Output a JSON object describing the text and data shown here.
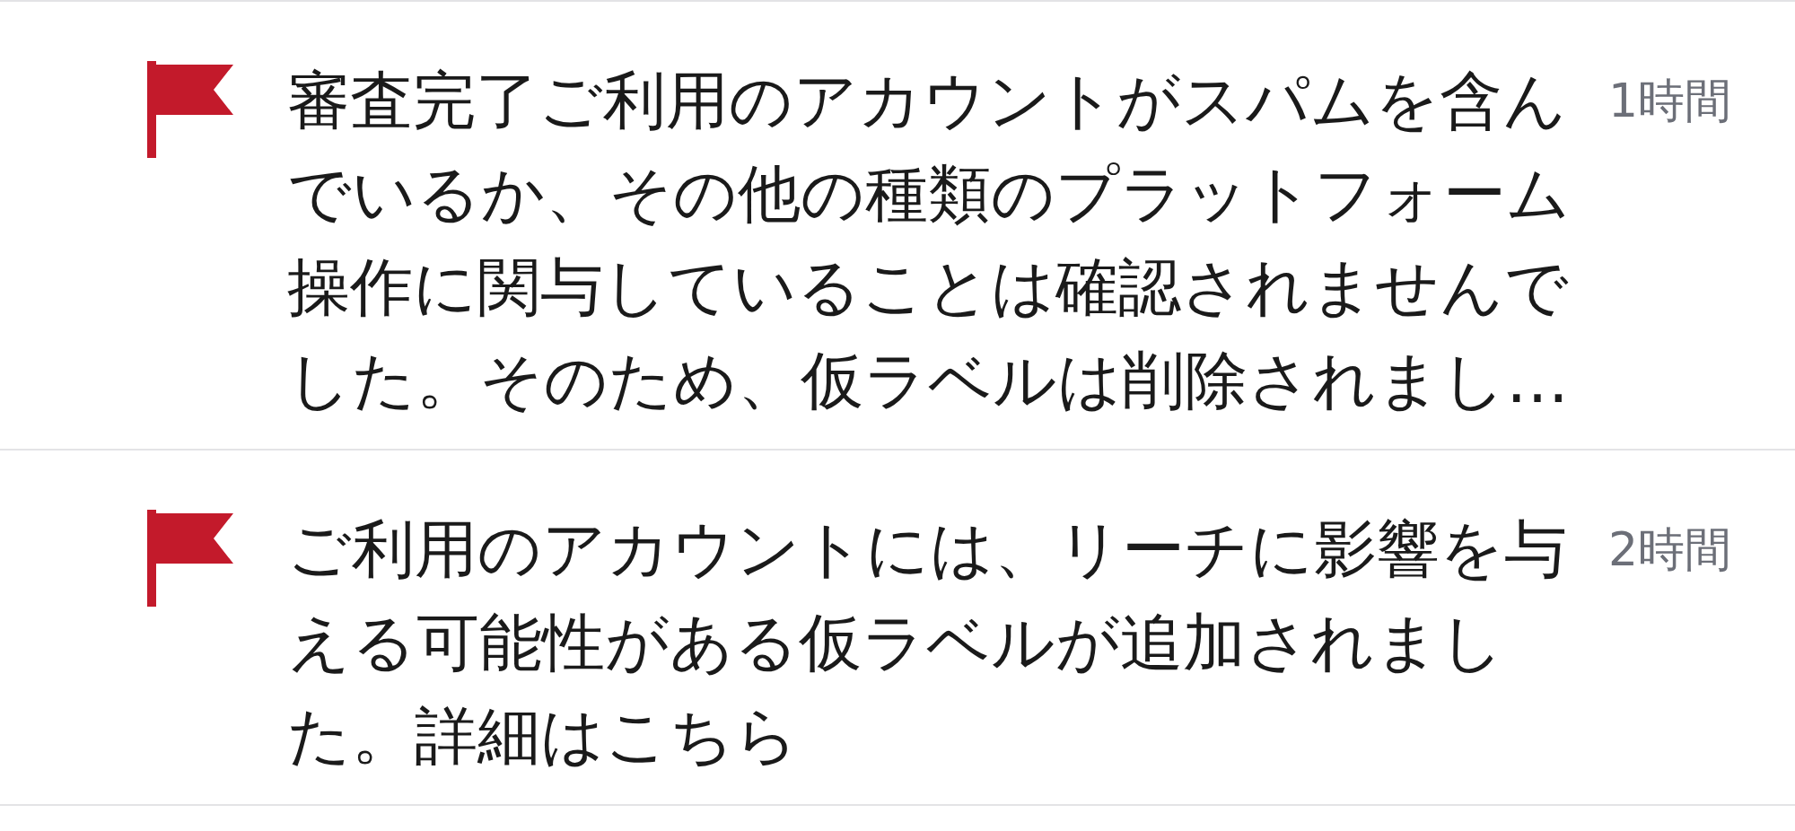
{
  "notifications": [
    {
      "text": "審査完了ご利用のアカウントがスパムを含んでいるか、その他の種類のプラットフォーム操作に関与していることは確認されませんでした。そのため、仮ラベルは削除されまし…",
      "time": "1時間"
    },
    {
      "text": "ご利用のアカウントには、リーチに影響を与える可能性がある仮ラベルが追加されました。詳細はこちら",
      "time": "2時間"
    }
  ]
}
